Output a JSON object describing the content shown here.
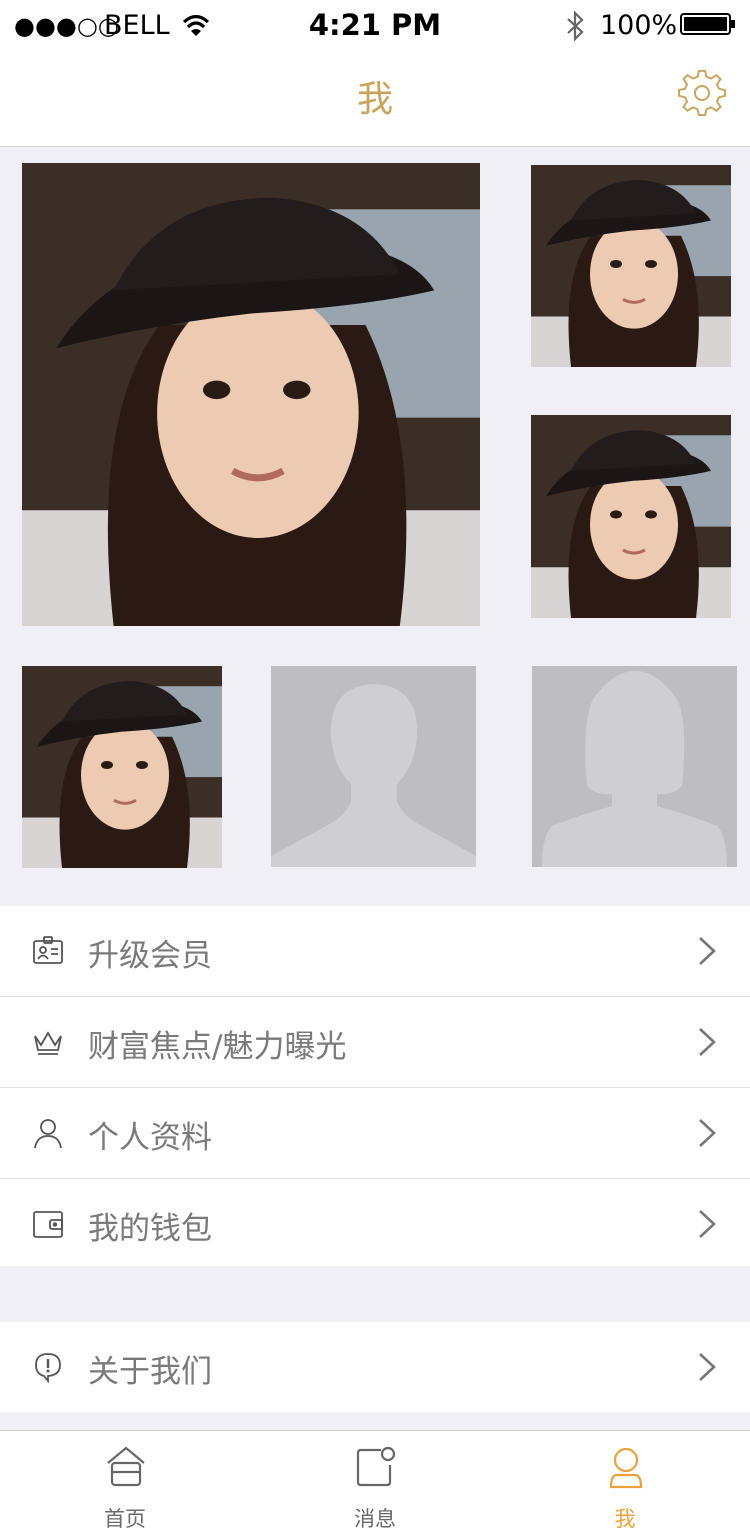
{
  "status_bar": {
    "signal": "●●●○○",
    "carrier": "BELL",
    "time": "4:21 PM",
    "battery": "100%"
  },
  "nav": {
    "title": "我",
    "settings_icon": "gear-icon"
  },
  "photos": [
    {
      "kind": "user-photo"
    },
    {
      "kind": "user-photo"
    },
    {
      "kind": "user-photo"
    },
    {
      "kind": "user-photo"
    },
    {
      "kind": "placeholder-male"
    },
    {
      "kind": "placeholder-female"
    }
  ],
  "menu": {
    "group1": [
      {
        "label": "升级会员",
        "icon": "id-card-icon"
      },
      {
        "label": "财富焦点/魅力曝光",
        "icon": "crown-icon"
      },
      {
        "label": "个人资料",
        "icon": "person-icon"
      },
      {
        "label": "我的钱包",
        "icon": "wallet-icon"
      }
    ],
    "group2": [
      {
        "label": "关于我们",
        "icon": "info-icon"
      }
    ]
  },
  "tabs": [
    {
      "label": "首页",
      "icon": "home-icon",
      "active": false
    },
    {
      "label": "消息",
      "icon": "message-icon",
      "active": false
    },
    {
      "label": "我",
      "icon": "profile-icon",
      "active": true
    }
  ],
  "colors": {
    "accent": "#c8a45c",
    "tab_active": "#e9a23b",
    "background": "#f0eff5"
  }
}
